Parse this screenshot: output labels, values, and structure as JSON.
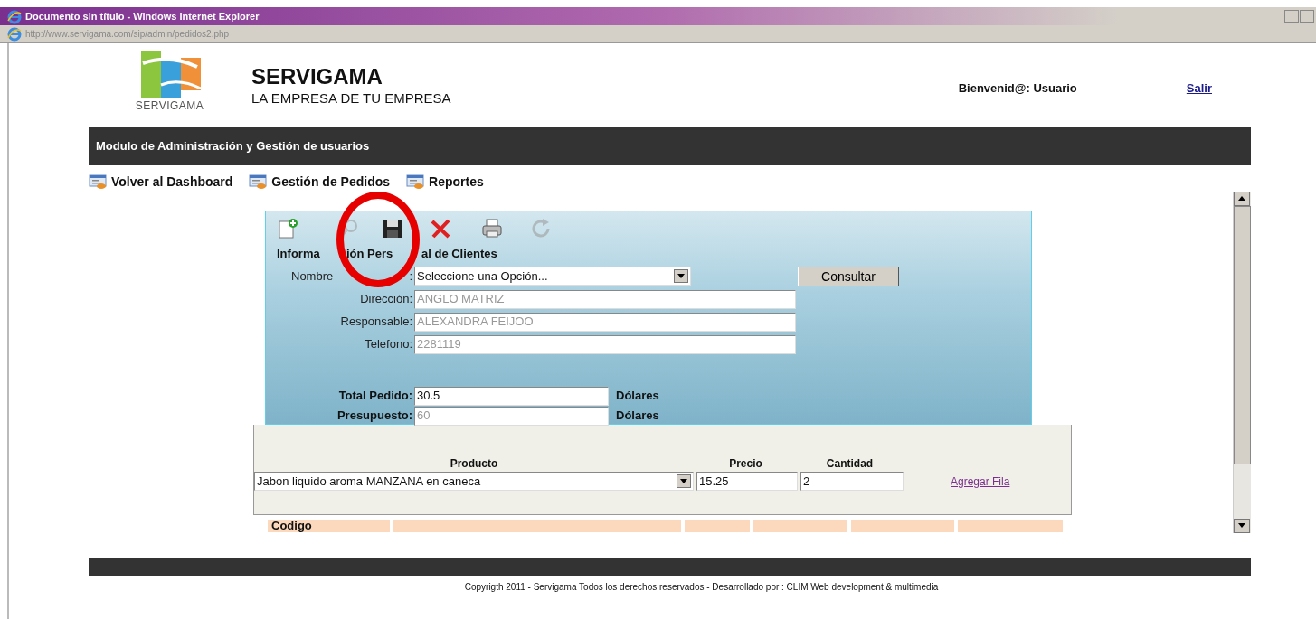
{
  "window": {
    "title": "Documento sin título - Windows Internet Explorer"
  },
  "address_bar": {
    "url": "http://www.servigama.com/sip/admin/pedidos2.php"
  },
  "header": {
    "logo_text": "SERVIGAMA",
    "brand": "SERVIGAMA",
    "tagline": "LA EMPRESA DE TU EMPRESA",
    "welcome": "Bienvenid@: Usuario",
    "logout": "Salir"
  },
  "module_bar": {
    "title": "Modulo de Administración y Gestión de usuarios"
  },
  "nav": [
    {
      "label": "Volver al Dashboard"
    },
    {
      "label": "Gestión de Pedidos"
    },
    {
      "label": "Reportes"
    }
  ],
  "toolbar": [
    {
      "kind": "new",
      "disabled": false
    },
    {
      "kind": "search",
      "disabled": true
    },
    {
      "kind": "save",
      "disabled": false
    },
    {
      "kind": "delete",
      "disabled": false
    },
    {
      "kind": "print",
      "disabled": false
    },
    {
      "kind": "refresh",
      "disabled": true
    }
  ],
  "form": {
    "title_parts": [
      "Informa",
      "ión Pers",
      "al de Clientes"
    ],
    "fields": [
      {
        "kind": "select",
        "label_parts": [
          "Nombre",
          ":"
        ],
        "value": "Seleccione una Opción...",
        "disabled": false
      },
      {
        "kind": "text",
        "label": "Dirección:",
        "value": "ANGLO MATRIZ",
        "disabled": true
      },
      {
        "kind": "text",
        "label": "Responsable:",
        "value": "ALEXANDRA FEIJOO",
        "disabled": true
      },
      {
        "kind": "text",
        "label": "Telefono:",
        "value": "2281119",
        "disabled": true
      }
    ],
    "button": "Consultar",
    "totals": [
      {
        "label": "Total Pedido:",
        "value": "30.5",
        "unit": "Dólares",
        "disabled": false
      },
      {
        "label": "Presupuesto:",
        "value": "60",
        "unit": "Dólares",
        "disabled": true
      }
    ]
  },
  "line_entry": {
    "columns": [
      "Producto",
      "Precio",
      "Cantidad"
    ],
    "product": "Jabon liquido aroma MANZANA en caneca",
    "price": "15.25",
    "quantity": "2",
    "add_link": "Agregar Fila"
  },
  "table": {
    "columns": [
      "Codigo"
    ]
  },
  "annotation": {
    "kind": "circle"
  },
  "footer": {
    "text": "Copyrigth 2011 - Servigama Todos los derechos reservados - Desarrollado por : CLIM Web development & multimedia"
  }
}
